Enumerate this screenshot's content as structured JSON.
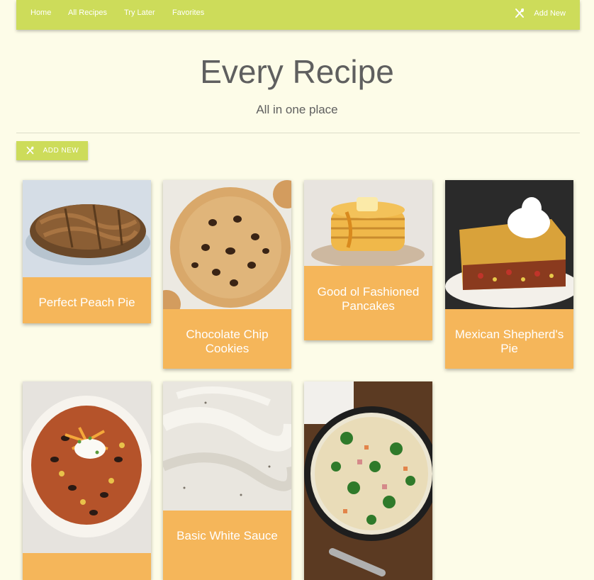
{
  "nav": {
    "links": [
      "Home",
      "All Recipes",
      "Try Later",
      "Favorites"
    ],
    "add_label": "Add New"
  },
  "hero": {
    "title": "Every Recipe",
    "subtitle": "All in one place"
  },
  "add_button": {
    "label": "ADD NEW"
  },
  "recipes": [
    {
      "title": "Perfect Peach Pie"
    },
    {
      "title": "Chocolate Chip Cookies"
    },
    {
      "title": "Good ol Fashioned Pancakes"
    },
    {
      "title": "Mexican Shepherd's Pie"
    },
    {
      "title": ""
    },
    {
      "title": "Basic White Sauce"
    },
    {
      "title": ""
    }
  ],
  "colors": {
    "nav": "#cddc5a",
    "background": "#fdfce8",
    "card": "#f5b65a",
    "text": "#5f5f5f"
  },
  "icons": {
    "utensils": "utensils-icon"
  }
}
